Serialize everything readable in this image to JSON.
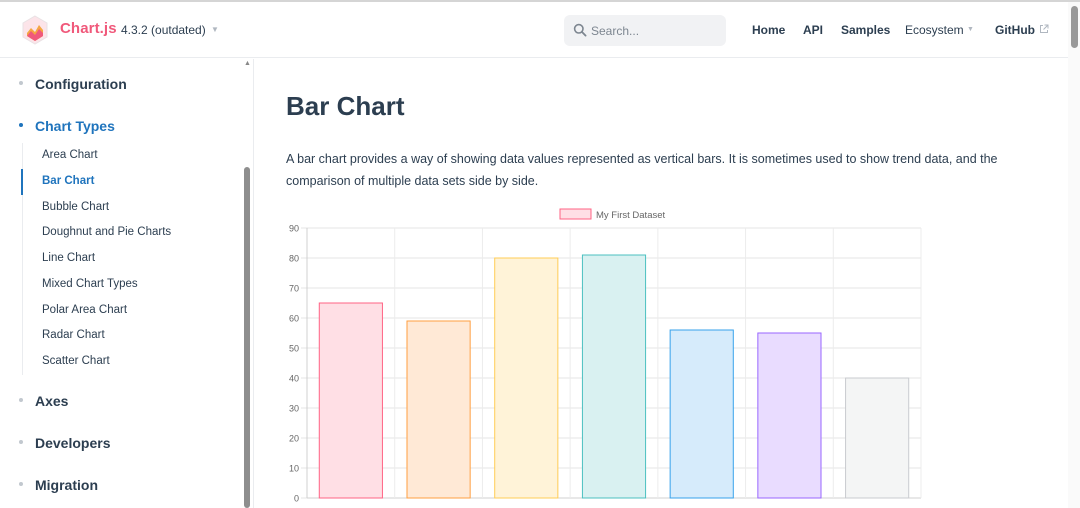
{
  "header": {
    "brand": "Chart.js",
    "version": "4.3.2 (outdated)",
    "search_placeholder": "Search...",
    "nav": [
      "Home",
      "API",
      "Samples",
      "Ecosystem",
      "GitHub"
    ]
  },
  "sidebar": {
    "groups": [
      {
        "label": "Configuration"
      },
      {
        "label": "Chart Types"
      },
      {
        "label": "Axes"
      },
      {
        "label": "Developers"
      },
      {
        "label": "Migration"
      }
    ],
    "chart_types_items": [
      "Area Chart",
      "Bar Chart",
      "Bubble Chart",
      "Doughnut and Pie Charts",
      "Line Chart",
      "Mixed Chart Types",
      "Polar Area Chart",
      "Radar Chart",
      "Scatter Chart"
    ],
    "active_item": "Bar Chart"
  },
  "main": {
    "title": "Bar Chart",
    "description": "A bar chart provides a way of showing data values represented as vertical bars. It is sometimes used to show trend data, and the comparison of multiple data sets side by side."
  },
  "chart_data": {
    "type": "bar",
    "categories": [
      "",
      "",
      "",
      "",
      "",
      "",
      ""
    ],
    "series": [
      {
        "name": "My First Dataset",
        "values": [
          65,
          59,
          80,
          81,
          56,
          55,
          40
        ]
      }
    ],
    "bar_fill_colors": [
      "#ffdfe5",
      "#ffe9d6",
      "#fff3d8",
      "#d9f1f1",
      "#d6ebfb",
      "#e9dcff",
      "#f4f5f5"
    ],
    "bar_border_colors": [
      "#ff6384",
      "#ff9f40",
      "#ffcd56",
      "#4bc0c0",
      "#36a2eb",
      "#9966ff",
      "#c9cbcf"
    ],
    "yticks": [
      0,
      10,
      20,
      30,
      40,
      50,
      60,
      70,
      80,
      90
    ],
    "ylim": [
      0,
      90
    ],
    "grid": true,
    "legend_position": "top",
    "title": "",
    "xlabel": "",
    "ylabel": ""
  },
  "colors": {
    "brand": "#f0597b",
    "accent": "#1f74bd",
    "text": "#2c3e50"
  }
}
